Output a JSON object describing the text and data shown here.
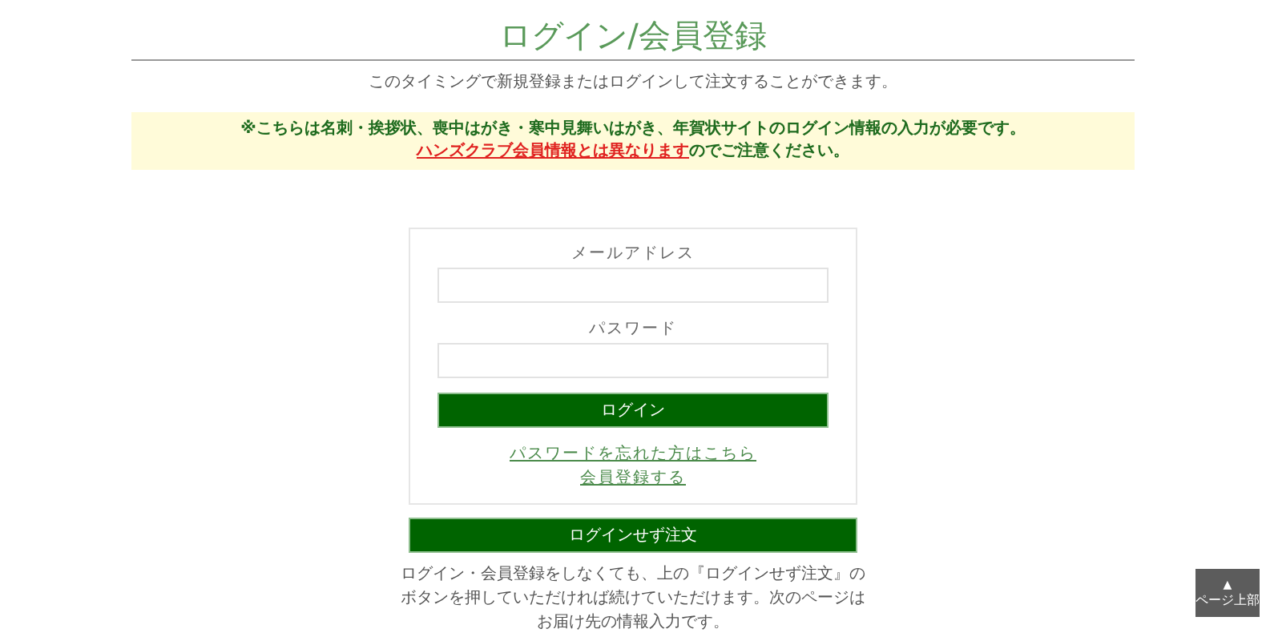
{
  "page_title": "ログイン/会員登録",
  "intro": "このタイミングで新規登録またはログインして注文することができます。",
  "notice": {
    "line_1": "※こちらは名刺・挨拶状、喪中はがき・寒中見舞いはがき、年賀状サイトのログイン情報の入力が必要です。",
    "warning_link": "ハンズクラブ会員情報とは異なります",
    "line_2_rest": "のでご注意ください。"
  },
  "login_form": {
    "fields": [
      {
        "label": "メールアドレス"
      },
      {
        "label": "パスワード"
      }
    ],
    "login_button": "ログイン",
    "links": [
      "パスワードを忘れた方はこちら",
      "会員登録する"
    ]
  },
  "guest_button": "ログインせず注文",
  "guest_note": "ログイン・会員登録をしなくても、上の『ログインせず注文』のボタンを押していただければ続けていただけます。次のページはお届け先の情報入力です。",
  "page_top": {
    "arrow": "▲",
    "label": "ページ上部"
  }
}
